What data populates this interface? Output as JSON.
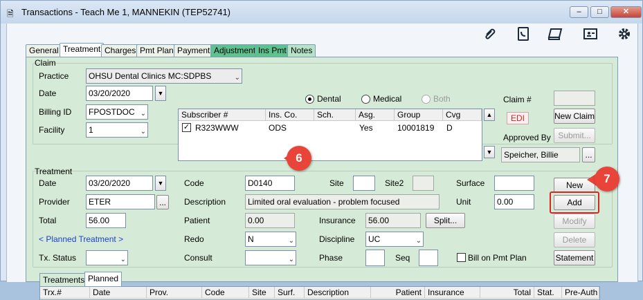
{
  "window": {
    "title": "Transactions - Teach Me 1, MANNEKIN (TEP52741)",
    "min_label": "–",
    "max_label": "□",
    "close_label": "✕"
  },
  "toolbar": {
    "icons": [
      "paperclip-icon",
      "phone-book-icon",
      "notebook-icon",
      "id-card-icon",
      "gear-icon"
    ]
  },
  "tabs": [
    "General",
    "Treatment",
    "Charges",
    "Pmt Plan",
    "Payment",
    "Adjustment",
    "Ins Pmt",
    "Notes"
  ],
  "claim": {
    "group_label": "Claim",
    "practice_label": "Practice",
    "practice_value": "OHSU Dental Clinics MC:SDPBS",
    "date_label": "Date",
    "date_value": "03/20/2020",
    "billing_label": "Billing ID",
    "billing_value": "FPOSTDOC",
    "facility_label": "Facility",
    "facility_value": "1",
    "radio_dental": "Dental",
    "radio_medical": "Medical",
    "radio_both": "Both",
    "claim_no_label": "Claim #",
    "edi_label": "EDI",
    "new_claim_label": "New Claim",
    "approved_label": "Approved By",
    "submit_label": "Submit...",
    "approved_value": "Speicher, Billie",
    "ellipsis": "...",
    "grid_headers": [
      "Subscriber #",
      "Ins. Co.",
      "Sch.",
      "Asg.",
      "Group",
      "Cvg"
    ],
    "grid_row": [
      "R323WWW",
      "ODS",
      "",
      "Yes",
      "10001819",
      "D"
    ]
  },
  "treatment": {
    "group_label": "Treatment",
    "date_label": "Date",
    "date_value": "03/20/2020",
    "provider_label": "Provider",
    "provider_value": "ETER",
    "total_label": "Total",
    "total_value": "56.00",
    "planned_link": "< Planned Treatment >",
    "txstatus_label": "Tx. Status",
    "code_label": "Code",
    "code_value": "D0140",
    "site_label": "Site",
    "site2_label": "Site2",
    "description_label": "Description",
    "description_value": "Limited oral evaluation - problem focused",
    "patient_label": "Patient",
    "patient_value": "0.00",
    "insurance_label": "Insurance",
    "insurance_value": "56.00",
    "split_label": "Split...",
    "redo_label": "Redo",
    "redo_value": "N",
    "discipline_label": "Discipline",
    "discipline_value": "UC",
    "consult_label": "Consult",
    "phase_label": "Phase",
    "seq_label": "Seq",
    "bill_on_pmt_plan": "Bill on Pmt Plan",
    "surface_label": "Surface",
    "unit_label": "Unit",
    "unit_value": "0.00",
    "new_label": "New",
    "add_label": "Add",
    "modify_label": "Modify",
    "delete_label": "Delete",
    "statement_label": "Statement"
  },
  "callouts": {
    "step6": "6",
    "step7": "7"
  },
  "bottom": {
    "tabs": [
      "Treatments",
      "Planned"
    ],
    "headers": [
      "Trx.#",
      "Date",
      "Prov.",
      "Code",
      "Site",
      "Surf.",
      "Description",
      "Patient",
      "Insurance",
      "Total",
      "Stat.",
      "Pre-Auth"
    ]
  },
  "colors": {
    "accent_red": "#d8251f",
    "panel_green": "#d6ebd7",
    "link_blue": "#1a3fd1"
  }
}
